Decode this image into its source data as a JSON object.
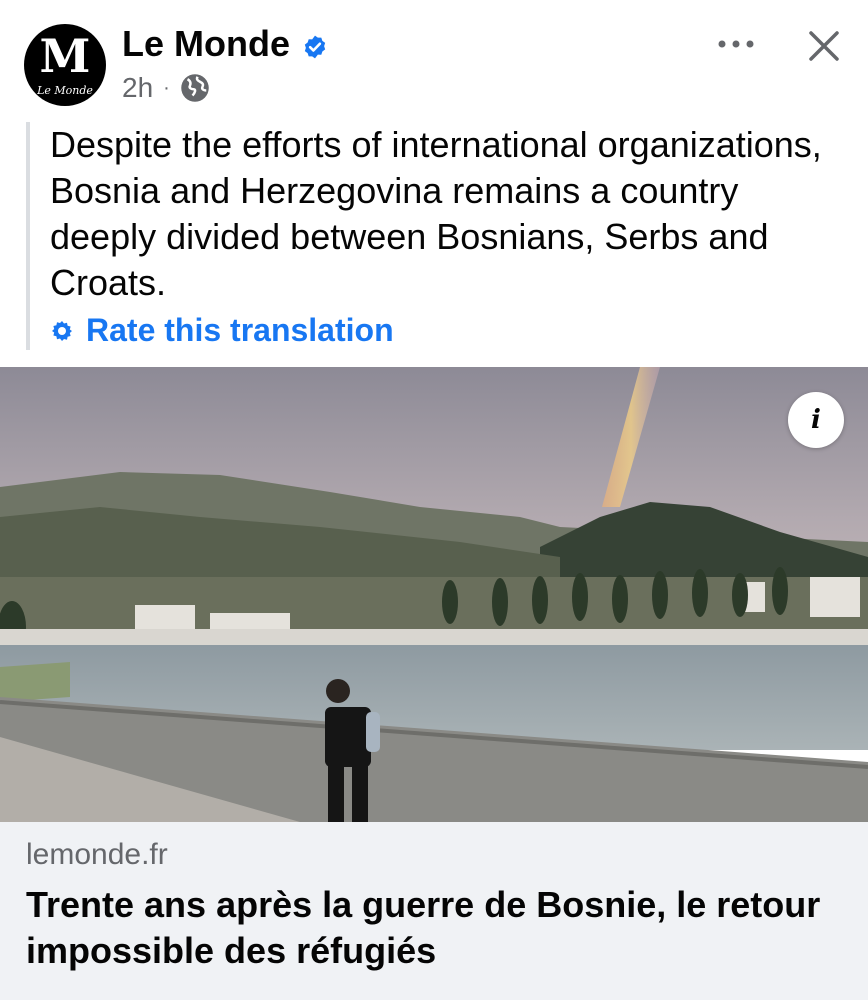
{
  "post": {
    "page_name": "Le Monde",
    "avatar_text": "M",
    "avatar_subtext": "Le Monde",
    "timestamp": "2h",
    "separator": "·",
    "audience_icon": "globe-icon",
    "verified_icon": "verified-badge-icon",
    "caption": "Despite the efforts of international organizations, Bosnia and Herzegovina remains a country deeply divided between Bosnians, Serbs and Croats.",
    "rate_translation": "Rate this translation"
  },
  "media": {
    "info_button": "i"
  },
  "link_preview": {
    "domain": "lemonde.fr",
    "headline": "Trente ans après la guerre de Bosnie, le retour impossible des réfugiés"
  },
  "colors": {
    "accent": "#1877f2",
    "secondary_text": "#65676b",
    "link_card_bg": "#f0f2f5"
  }
}
